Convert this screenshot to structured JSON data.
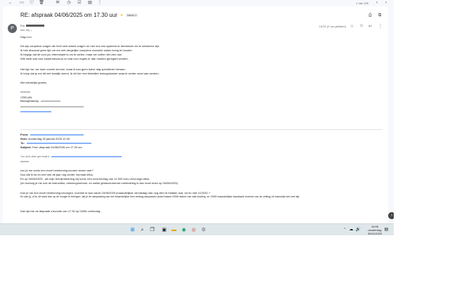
{
  "toolbar": {
    "pager": "1 van 230"
  },
  "email": {
    "subject": "RE: afspraak 04/06/2025 om 17.30 uur",
    "label": "Inbox ×",
    "avatar_letter": "P",
    "sender_prefix": "Fro",
    "to_me": "aan mij ⌄",
    "date": "13:02 (2 uur geleden)",
    "greeting": "Dag ",
    "body_lines": [
      "Dit zijn complexe vragen die heel veel arbeid vragen en niet ons een systeem te berekenen en te simuleren zijn.",
      "Ik heb absoluut geen tijd om me met dergelijke complexe manuele zaken bezig te houden",
      "Ik begrijp dat dit voor jou interessant is om te weten, maar we zullen niet zien dan",
      "Wie weet wat voor kostenstructuur en wat voor regels er dan moeten geregeld worden."
    ],
    "body_lines2": [
      "Het ligt me, we doen zoveel service, maar ik kan geen halve dag spenderen hieraan.",
      "Ik hoop dat je me dit niet kwalijk neemt. Ik zit hier met tientallen leningsdossier waar ik verder moet aan werken."
    ],
    "closing": "Met vriendelijke groeten,",
    "sig_company": "CRELAN",
    "sig_line": "Bankagentschap",
    "quoted_header": {
      "from_label": "From:",
      "sent_label": "Sent:",
      "sent_value": "donderdag 30 januari 2025 12:30",
      "to_label": "To:",
      "subject_label": "Subject:",
      "subject_value": "Fwd: afspraak 04/06/2025 om 17.30 uur"
    },
    "warning": "You don't often get email fr",
    "question_lines": [
      "zou je me soms een excel berekening kunnen sturen aub?",
      "Dus dat ik tot en met mei dit jaar nog verder normaal aflos.",
      "En op 04/06/2025 , als mijn termijnrekening vrij komt, een rond bedrag van 12.000 euro vervroegd aflos.",
      "(en hoezeg je me ook de instructies, rekeningnummer, en welke gestructureerde mededeling ik dan moet doen op 04/06/2025)"
    ],
    "question_lines2": [
      "Kan je me een excel berekening bezorgen, hoeveel ik dan vanaf 13/06/2025 (maandelijkse vervaldag) dan nog dien te betalen aub, tot en met 11/2032 ?",
      "En dan jij, of ik, de bank dan op de hoogte te brengen, dat je de aanpassing van het maandelijkse leen bedrag aanpassen (want tussen 04/06 datum van mijn storting, en 13/06 maandelijkse standaard moment van de zelling) zit natuurlijk niet veel tijd ."
    ],
    "final_line": "Dan tijd me de afspraak s'avonds van 17.30 op 04/06 overbodig..."
  },
  "taskbar": {
    "time": "15:55",
    "day": "donderdag",
    "date": "30/01/2025"
  },
  "colors": {
    "background": "#f6f8fc",
    "panel": "#ffffff",
    "taskbar": "#dfe7ea",
    "accent": "#1a73e8"
  }
}
